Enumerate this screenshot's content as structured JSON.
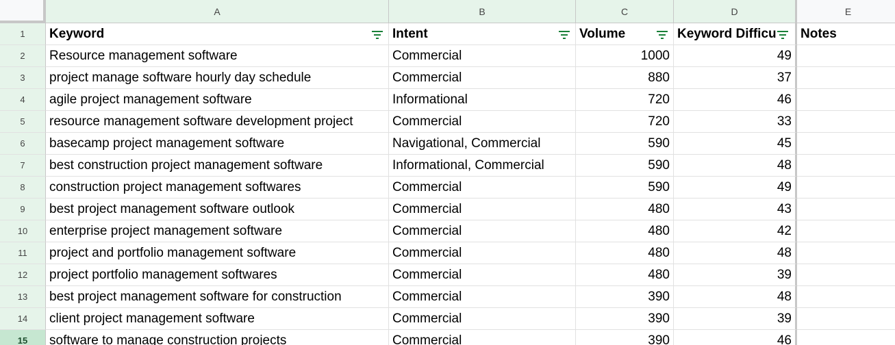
{
  "columns": [
    "A",
    "B",
    "C",
    "D",
    "E"
  ],
  "header_row": {
    "number": "1",
    "cells": [
      "Keyword",
      "Intent",
      "Volume",
      "Keyword Difficu",
      "Notes"
    ]
  },
  "filter_icon": "filter-icon",
  "rows": [
    {
      "num": "2",
      "keyword": "Resource management software",
      "intent": "Commercial",
      "volume": "1000",
      "difficulty": "49",
      "notes": ""
    },
    {
      "num": "3",
      "keyword": "project manage software hourly day schedule",
      "intent": "Commercial",
      "volume": "880",
      "difficulty": "37",
      "notes": ""
    },
    {
      "num": "4",
      "keyword": "agile project management software",
      "intent": "Informational",
      "volume": "720",
      "difficulty": "46",
      "notes": ""
    },
    {
      "num": "5",
      "keyword": "resource management software development project",
      "intent": "Commercial",
      "volume": "720",
      "difficulty": "33",
      "notes": ""
    },
    {
      "num": "6",
      "keyword": "basecamp project management software",
      "intent": "Navigational, Commercial",
      "volume": "590",
      "difficulty": "45",
      "notes": ""
    },
    {
      "num": "7",
      "keyword": "best construction project management software",
      "intent": "Informational, Commercial",
      "volume": "590",
      "difficulty": "48",
      "notes": ""
    },
    {
      "num": "8",
      "keyword": "construction project management softwares",
      "intent": "Commercial",
      "volume": "590",
      "difficulty": "49",
      "notes": ""
    },
    {
      "num": "9",
      "keyword": "best project management software outlook",
      "intent": "Commercial",
      "volume": "480",
      "difficulty": "43",
      "notes": ""
    },
    {
      "num": "10",
      "keyword": "enterprise project management software",
      "intent": "Commercial",
      "volume": "480",
      "difficulty": "42",
      "notes": ""
    },
    {
      "num": "11",
      "keyword": "project and portfolio management software",
      "intent": "Commercial",
      "volume": "480",
      "difficulty": "48",
      "notes": ""
    },
    {
      "num": "12",
      "keyword": "project portfolio management softwares",
      "intent": "Commercial",
      "volume": "480",
      "difficulty": "39",
      "notes": ""
    },
    {
      "num": "13",
      "keyword": "best project management software for construction",
      "intent": "Commercial",
      "volume": "390",
      "difficulty": "48",
      "notes": ""
    },
    {
      "num": "14",
      "keyword": "client project management software",
      "intent": "Commercial",
      "volume": "390",
      "difficulty": "39",
      "notes": ""
    },
    {
      "num": "15",
      "keyword": "software to manage construction projects",
      "intent": "Commercial",
      "volume": "390",
      "difficulty": "46",
      "notes": ""
    }
  ],
  "active_row": "15",
  "colors": {
    "header_green": "#e6f4ea",
    "filter_green": "#188038",
    "gridline": "#e1e1e1"
  }
}
